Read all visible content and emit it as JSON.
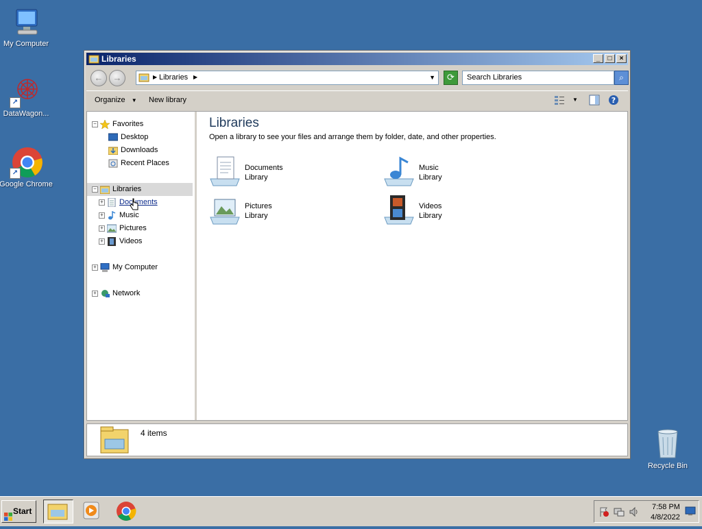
{
  "desktop": {
    "icons": [
      {
        "label": "My Computer"
      },
      {
        "label": "DataWagon..."
      },
      {
        "label": "Google Chrome"
      },
      {
        "label": "Recycle Bin"
      }
    ]
  },
  "window": {
    "title": "Libraries",
    "address": {
      "crumb": "Libraries"
    },
    "search_placeholder": "Search Libraries",
    "toolbar": {
      "organize": "Organize",
      "new_library": "New library"
    },
    "nav": {
      "favorites": "Favorites",
      "desktop": "Desktop",
      "downloads": "Downloads",
      "recent_places": "Recent Places",
      "libraries": "Libraries",
      "documents": "Documents",
      "music": "Music",
      "pictures": "Pictures",
      "videos": "Videos",
      "my_computer": "My Computer",
      "network": "Network"
    },
    "main": {
      "title": "Libraries",
      "description": "Open a library to see your files and arrange them by folder, date, and other properties.",
      "libraries": [
        {
          "name": "Documents",
          "type": "Library"
        },
        {
          "name": "Music",
          "type": "Library"
        },
        {
          "name": "Pictures",
          "type": "Library"
        },
        {
          "name": "Videos",
          "type": "Library"
        }
      ]
    },
    "details": {
      "count": "4 items"
    }
  },
  "taskbar": {
    "start": "Start",
    "time": "7:58 PM",
    "date": "4/8/2022"
  }
}
